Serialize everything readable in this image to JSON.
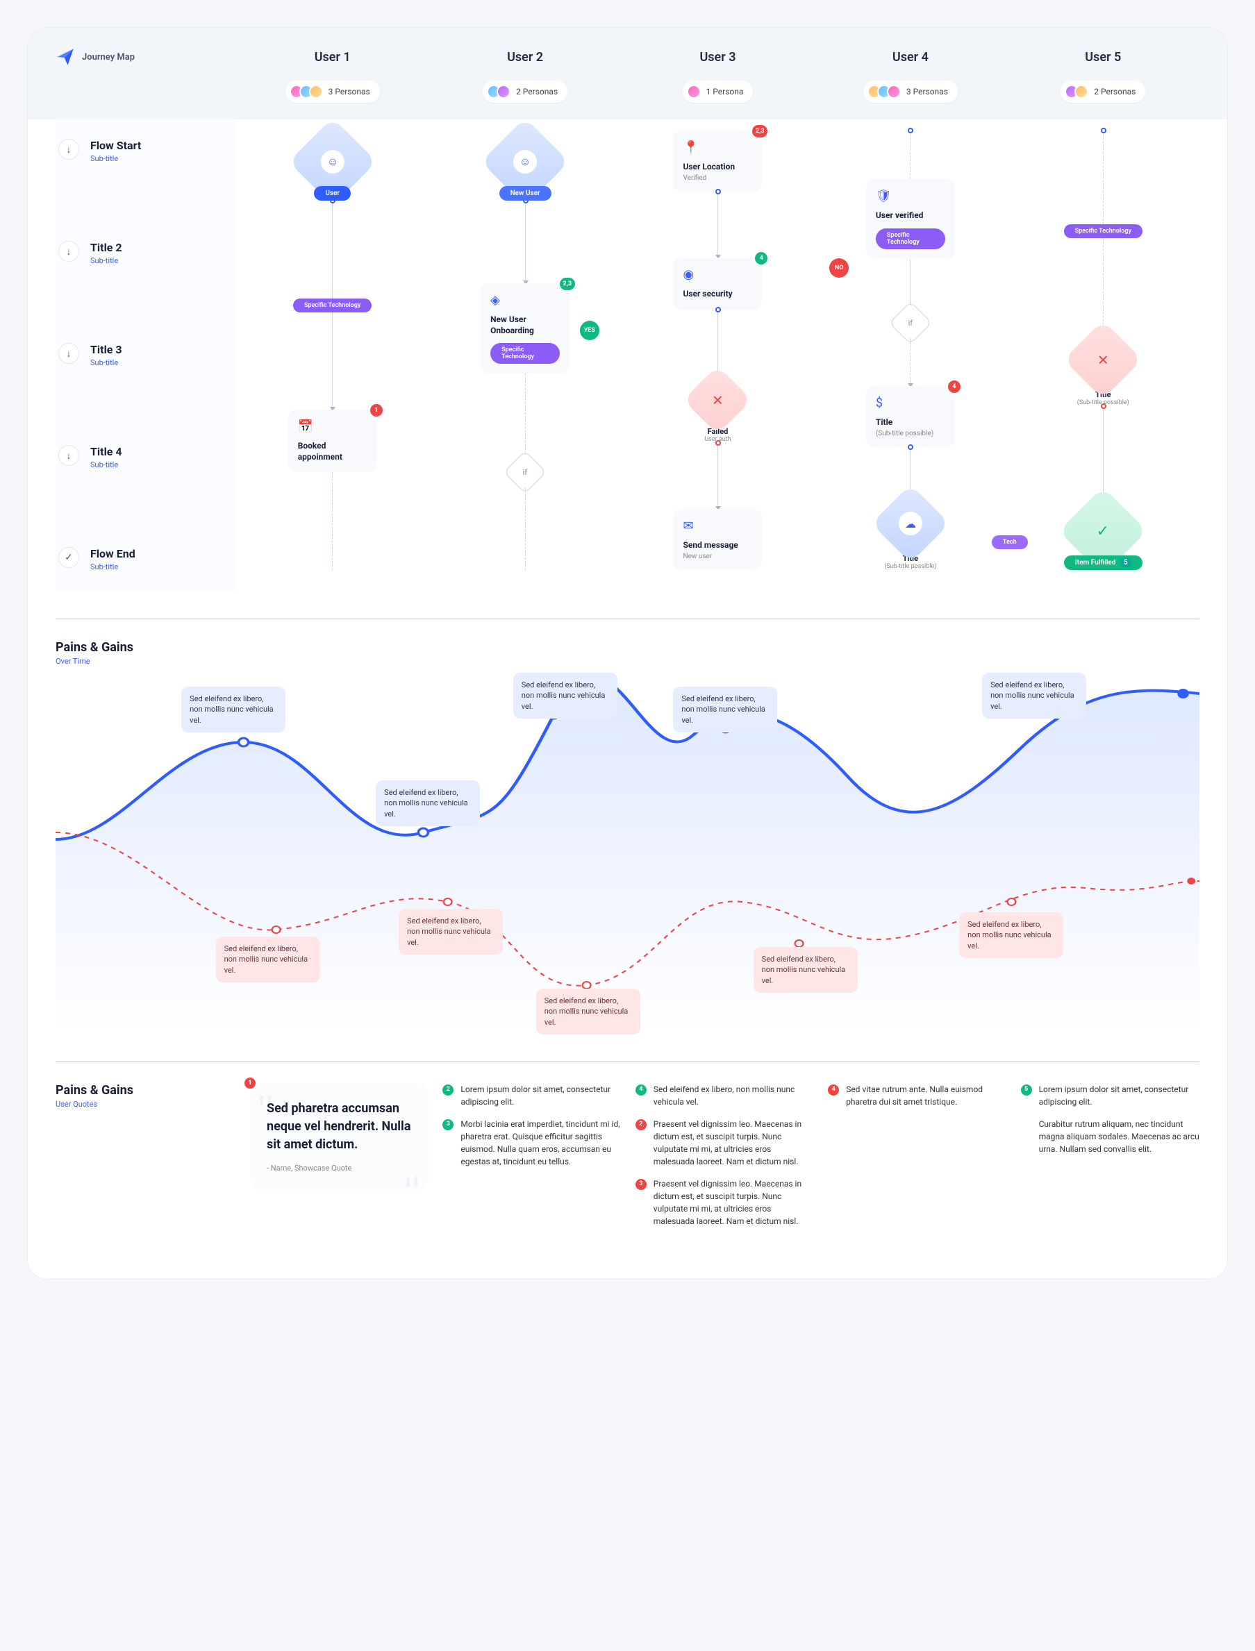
{
  "header": {
    "logo_label": "Journey Map",
    "user_cols": [
      "User 1",
      "User 2",
      "User 3",
      "User 4",
      "User 5"
    ],
    "personas": [
      "3 Personas",
      "2 Personas",
      "1 Persona",
      "3 Personas",
      "2 Personas"
    ]
  },
  "rows": [
    {
      "title": "Flow Start",
      "sub": "Sub-title",
      "icon": "↓"
    },
    {
      "title": "Title 2",
      "sub": "Sub-title",
      "icon": "↓"
    },
    {
      "title": "Title 3",
      "sub": "Sub-title",
      "icon": "↓"
    },
    {
      "title": "Title 4",
      "sub": "Sub-title",
      "icon": "↓"
    },
    {
      "title": "Flow End",
      "sub": "Sub-title",
      "icon": "✓"
    }
  ],
  "flow": {
    "u1": {
      "start_pill": "User",
      "tech_pill": "Specific Technology",
      "card1": {
        "title": "Booked appoinment",
        "badge": "1"
      }
    },
    "u2": {
      "start_pill": "New User",
      "card1": {
        "title": "New User Onboarding",
        "badge": "2,3",
        "tech": "Specific Technology"
      }
    },
    "u3": {
      "card_loc": {
        "title": "User Location",
        "sub": "Verified",
        "badge": "2,3"
      },
      "card_sec": {
        "title": "User security",
        "badge": "4"
      },
      "failed": {
        "title": "Failed",
        "sub": "User auth"
      },
      "card_msg": {
        "title": "Send message",
        "sub": "New user"
      },
      "yes": "YES",
      "no": "NO"
    },
    "u4": {
      "card_ver": {
        "title": "User verified",
        "tech": "Specific Technology"
      },
      "card_title": {
        "title": "Title",
        "sub": "(Sub-title possible)",
        "badge": "4"
      },
      "card_end": {
        "title": "Title",
        "sub": "(Sub-title possible)"
      },
      "tech_chip": "Tech"
    },
    "u5": {
      "tech_pill": "Specific Technology",
      "card_title": {
        "title": "Title",
        "sub": "(Sub-title possible)"
      },
      "fulfilled": "Item Fulfilled",
      "fulfilled_badge": "5"
    }
  },
  "pains": {
    "title": "Pains & Gains",
    "sub": "Over Time",
    "note": "Sed eleifend ex libero, non mollis nunc vehicula vel."
  },
  "quotes": {
    "title": "Pains & Gains",
    "sub": "User Quotes",
    "big": {
      "text": "Sed pharetra accumsan neque vel hendrerit. Nulla sit amet dictum.",
      "author": "- Name, Showcase Quote",
      "badge": "1"
    },
    "cols": [
      [
        {
          "n": "2",
          "c": "g",
          "t": "Lorem ipsum dolor sit amet, consectetur adipiscing elit."
        },
        {
          "n": "3",
          "c": "g",
          "t": "Morbi lacinia erat imperdiet, tincidunt mi id, pharetra erat. Quisque efficitur sagittis euismod. Nulla quam eros, accumsan eu egestas at, tincidunt eu tellus."
        }
      ],
      [
        {
          "n": "4",
          "c": "g",
          "t": "Sed eleifend ex libero, non mollis nunc vehicula vel."
        },
        {
          "n": "2",
          "c": "r",
          "t": "Praesent vel dignissim leo. Maecenas in dictum est, et suscipit turpis. Nunc vulputate mi mi, at ultricies eros malesuada laoreet. Nam et dictum nisl."
        },
        {
          "n": "3",
          "c": "r",
          "t": "Praesent vel dignissim leo. Maecenas in dictum est, et suscipit turpis. Nunc vulputate mi mi, at ultricies eros malesuada laoreet. Nam et dictum nisl."
        }
      ],
      [
        {
          "n": "4",
          "c": "r",
          "t": "Sed vitae rutrum ante. Nulla euismod pharetra dui sit amet tristique."
        }
      ],
      [
        {
          "n": "5",
          "c": "g",
          "t": "Lorem ipsum dolor sit amet, consectetur adipiscing elit."
        },
        {
          "n": "",
          "c": "",
          "t": "Curabitur rutrum aliquam, nec tincidunt magna aliquam sodales. Maecenas ac arcu urna. Nullam sed convallis elit."
        }
      ]
    ]
  }
}
